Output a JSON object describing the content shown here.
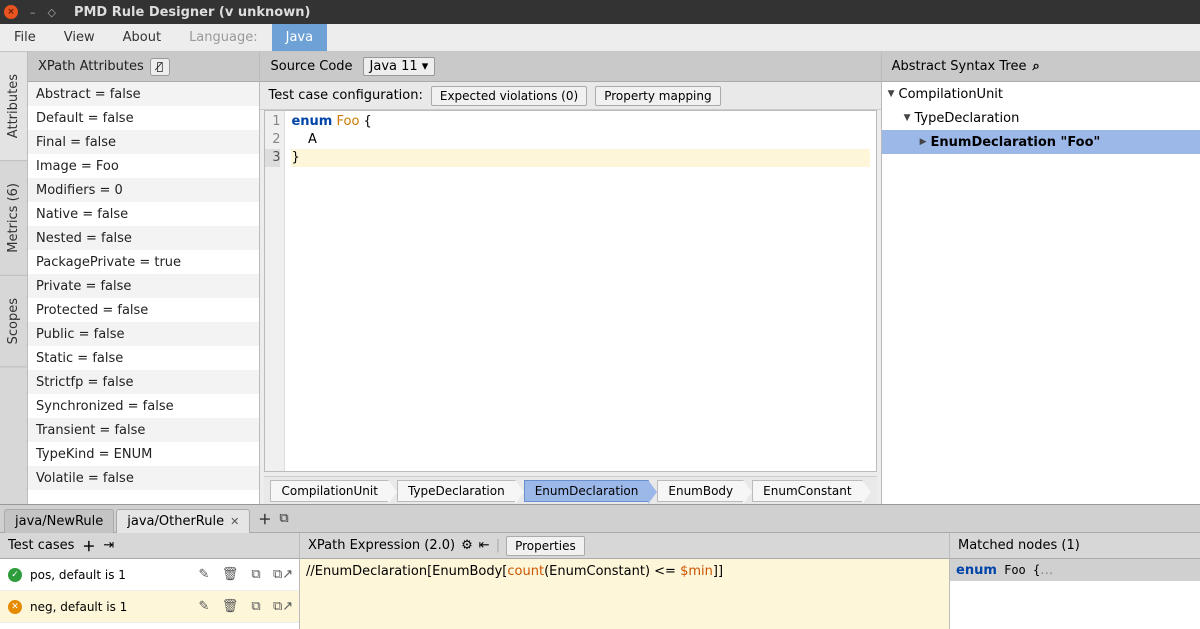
{
  "titlebar": {
    "title": "PMD Rule Designer (v unknown)"
  },
  "menu": {
    "file": "File",
    "view": "View",
    "about": "About",
    "language_label": "Language:",
    "language_value": "Java"
  },
  "xpath_attrs": {
    "title": "XPath Attributes",
    "items": [
      "Abstract = false",
      "Default = false",
      "Final = false",
      "Image = Foo",
      "Modifiers = 0",
      "Native = false",
      "Nested = false",
      "PackagePrivate = true",
      "Private = false",
      "Protected = false",
      "Public = false",
      "Static = false",
      "Strictfp = false",
      "Synchronized = false",
      "Transient = false",
      "TypeKind = ENUM",
      "Volatile = false"
    ]
  },
  "vtabs": {
    "attributes": "Attributes",
    "metrics": "Metrics   (6)",
    "scopes": "Scopes"
  },
  "source": {
    "title": "Source Code",
    "lang": "Java 11",
    "testcfg_label": "Test case configuration:",
    "expected_violations": "Expected violations (0)",
    "property_mapping": "Property mapping",
    "lines": {
      "l1_kw": "enum",
      "l1_name": " Foo ",
      "l1_rest": "{",
      "l2": "    A",
      "l3": "}"
    },
    "crumbs": [
      "CompilationUnit",
      "TypeDeclaration",
      "EnumDeclaration",
      "EnumBody",
      "EnumConstant"
    ]
  },
  "ast": {
    "title": "Abstract Syntax Tree",
    "n0": "CompilationUnit",
    "n1": "TypeDeclaration",
    "n2": "EnumDeclaration \"Foo\""
  },
  "tabs": {
    "t1": "java/NewRule",
    "t2": "java/OtherRule"
  },
  "testcases": {
    "title": "Test cases",
    "rows": [
      {
        "status": "pass",
        "name": "pos, default is 1"
      },
      {
        "status": "fail",
        "name": "neg, default is 1"
      }
    ]
  },
  "xpath": {
    "title": "XPath Expression (2.0)",
    "properties_btn": "Properties",
    "expr_pre": "//EnumDeclaration[EnumBody[",
    "expr_func": "count",
    "expr_mid": "(EnumConstant) <= ",
    "expr_var": "$min",
    "expr_post": "]]"
  },
  "matched": {
    "title": "Matched nodes (1)",
    "row0": "enum Foo {…"
  }
}
